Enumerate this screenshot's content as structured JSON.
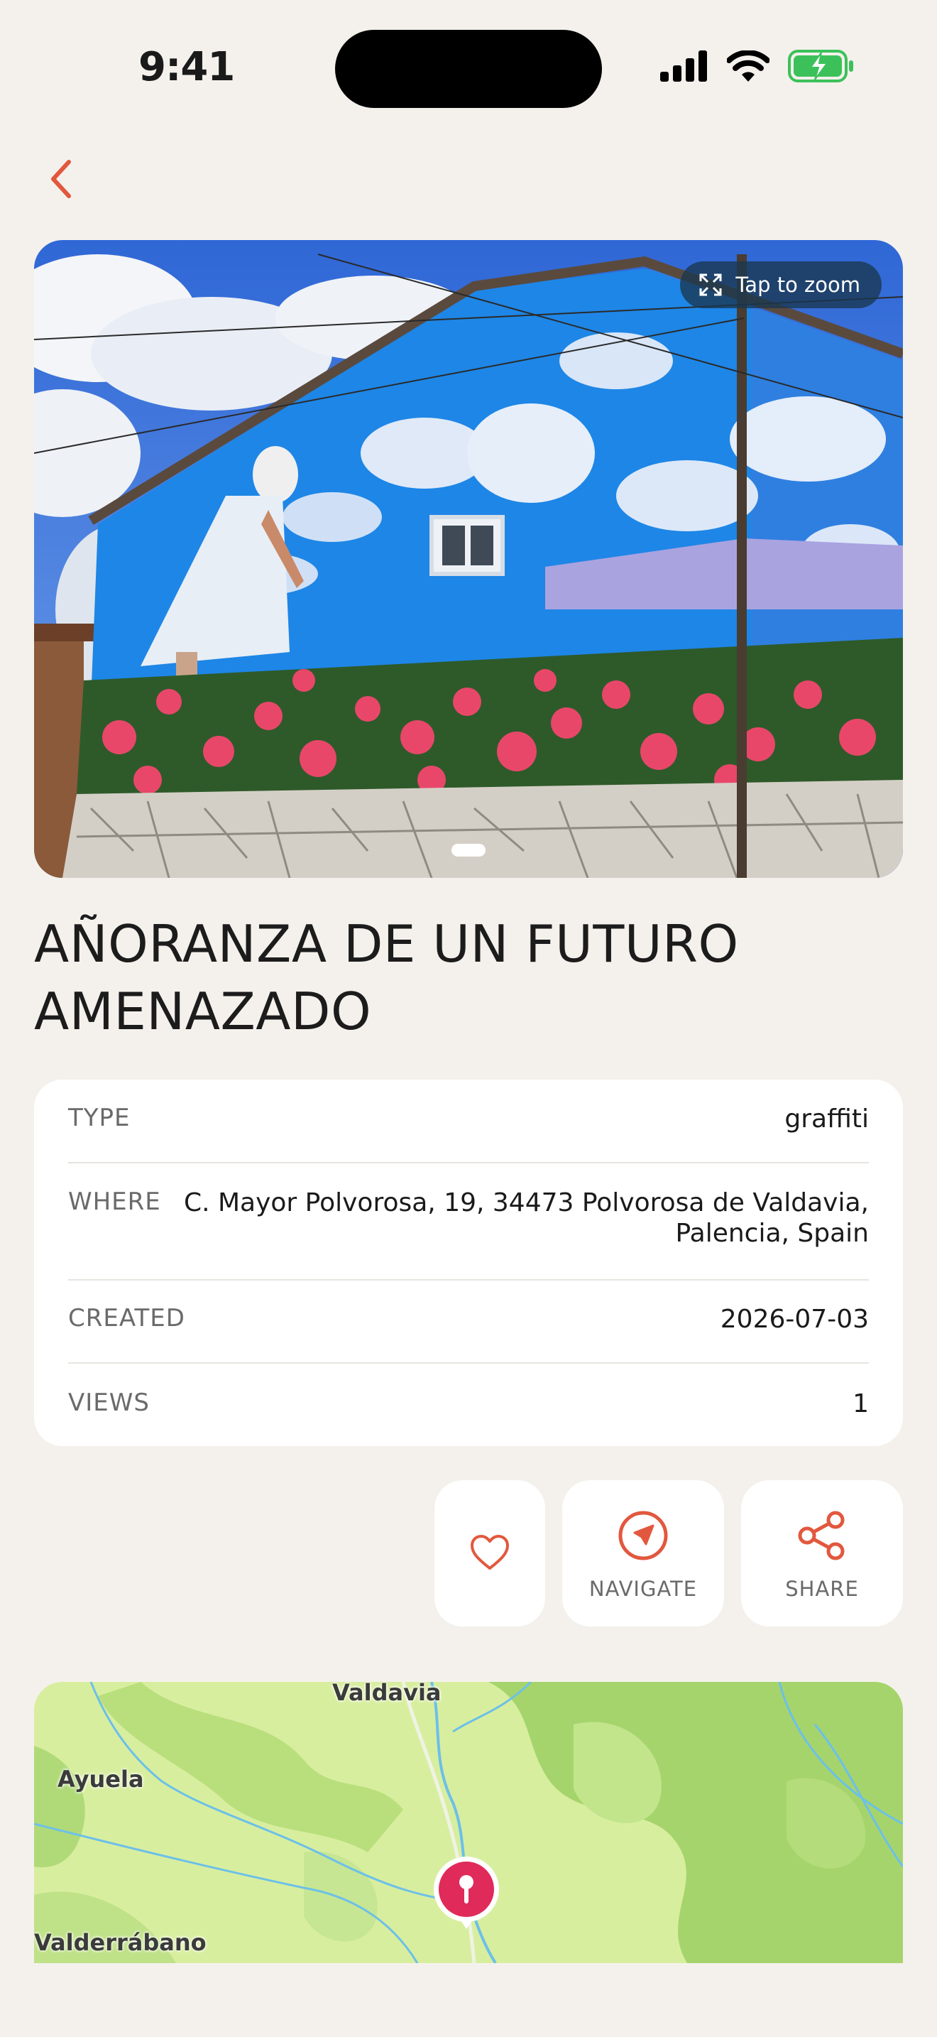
{
  "status_bar": {
    "time": "9:41"
  },
  "hero": {
    "zoom_label": "Tap to zoom"
  },
  "title": "AÑORANZA DE UN FUTURO AMENAZADO",
  "info": {
    "type_label": "TYPE",
    "type_value": "graffiti",
    "where_label": "WHERE",
    "where_line1": "C. Mayor Polvorosa, 19, 34473 Polvorosa de Valdavia,",
    "where_line2": "Palencia, Spain",
    "created_label": "CREATED",
    "created_value": "2026-07-03",
    "views_label": "VIEWS",
    "views_value": "1"
  },
  "actions": {
    "navigate_label": "NAVIGATE",
    "share_label": "SHARE"
  },
  "map": {
    "place_1": "Valdavia",
    "place_2": "Ayuela",
    "place_3": "Valderrábano"
  },
  "colors": {
    "accent": "#e2583e",
    "background": "#f4f1ec",
    "pin": "#e02a5a",
    "map_land": "#d8ee9f"
  }
}
